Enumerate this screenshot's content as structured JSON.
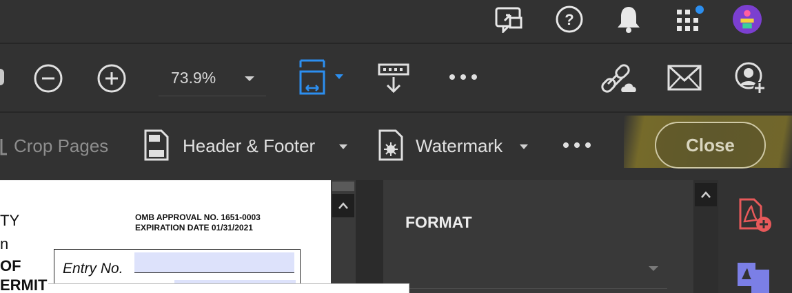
{
  "topbar": {
    "icons": [
      "comment-share-icon",
      "help-icon",
      "bell-icon",
      "apps-grid-icon",
      "avatar"
    ]
  },
  "toolbar": {
    "zoom_out": "zoom-out-icon",
    "zoom_in": "zoom-in-icon",
    "zoom": {
      "value": "73.9%"
    },
    "fit_page": "fit-page-icon",
    "scroll_mode": "scroll-mode-icon",
    "more": "more-icon",
    "share_link": "share-link-icon",
    "email": "email-icon",
    "add_user": "add-user-icon"
  },
  "subbar": {
    "crop_pages": "Crop Pages",
    "header_footer": "Header & Footer",
    "watermark": "Watermark",
    "close": "Close"
  },
  "document": {
    "left_fragments": [
      "TY",
      "n",
      "OF",
      "ERMIT"
    ],
    "omb_line1": "OMB APPROVAL NO. 1651-0003",
    "omb_line2": "EXPIRATION DATE 01/31/2021",
    "entry_label": "Entry No."
  },
  "panel": {
    "title": "FORMAT"
  },
  "colors": {
    "accent_blue": "#2c8ff0",
    "pdf_red": "#e8595a",
    "highlight": "#8c7d2a"
  }
}
